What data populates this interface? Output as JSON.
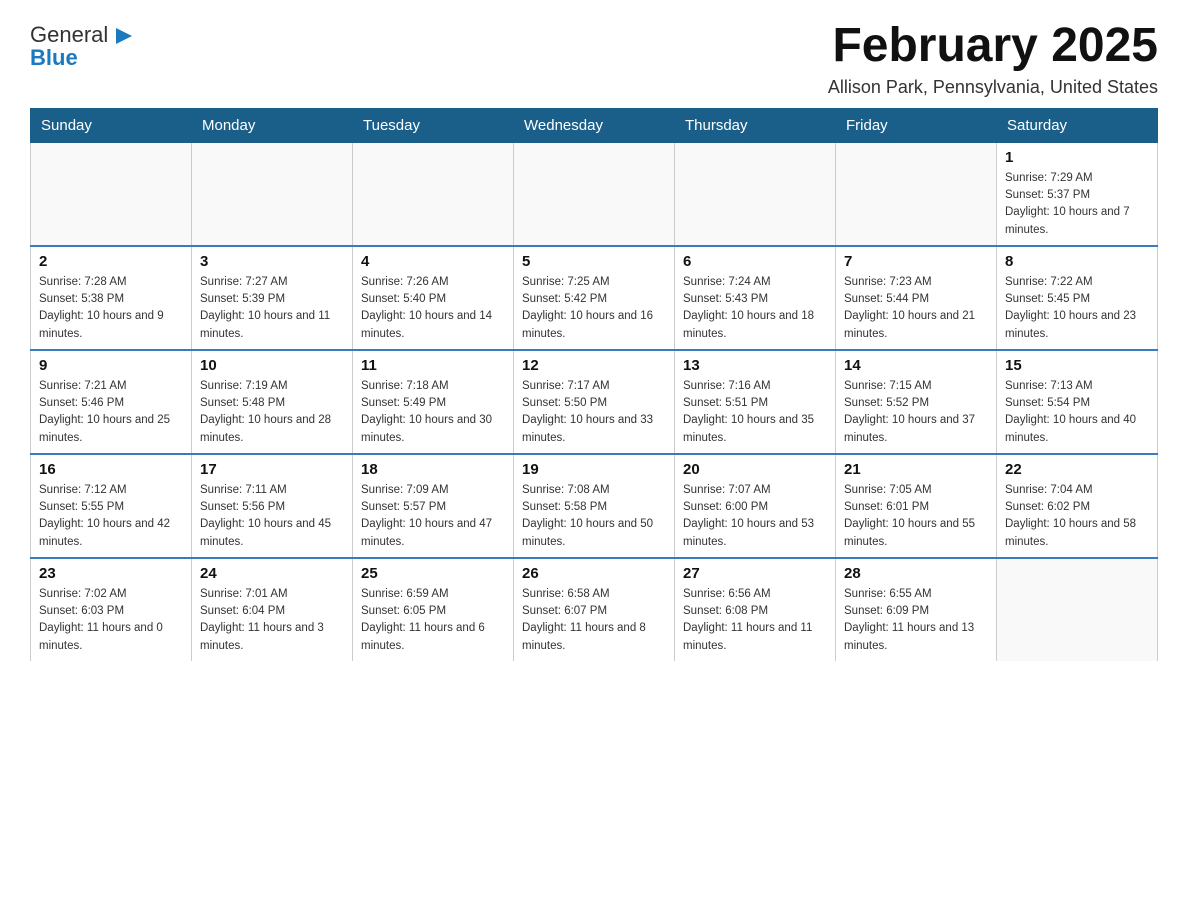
{
  "header": {
    "logo_general": "General",
    "logo_blue": "Blue",
    "month_title": "February 2025",
    "location": "Allison Park, Pennsylvania, United States"
  },
  "days_of_week": [
    "Sunday",
    "Monday",
    "Tuesday",
    "Wednesday",
    "Thursday",
    "Friday",
    "Saturday"
  ],
  "weeks": [
    {
      "days": [
        {
          "number": "",
          "info": ""
        },
        {
          "number": "",
          "info": ""
        },
        {
          "number": "",
          "info": ""
        },
        {
          "number": "",
          "info": ""
        },
        {
          "number": "",
          "info": ""
        },
        {
          "number": "",
          "info": ""
        },
        {
          "number": "1",
          "info": "Sunrise: 7:29 AM\nSunset: 5:37 PM\nDaylight: 10 hours and 7 minutes."
        }
      ]
    },
    {
      "days": [
        {
          "number": "2",
          "info": "Sunrise: 7:28 AM\nSunset: 5:38 PM\nDaylight: 10 hours and 9 minutes."
        },
        {
          "number": "3",
          "info": "Sunrise: 7:27 AM\nSunset: 5:39 PM\nDaylight: 10 hours and 11 minutes."
        },
        {
          "number": "4",
          "info": "Sunrise: 7:26 AM\nSunset: 5:40 PM\nDaylight: 10 hours and 14 minutes."
        },
        {
          "number": "5",
          "info": "Sunrise: 7:25 AM\nSunset: 5:42 PM\nDaylight: 10 hours and 16 minutes."
        },
        {
          "number": "6",
          "info": "Sunrise: 7:24 AM\nSunset: 5:43 PM\nDaylight: 10 hours and 18 minutes."
        },
        {
          "number": "7",
          "info": "Sunrise: 7:23 AM\nSunset: 5:44 PM\nDaylight: 10 hours and 21 minutes."
        },
        {
          "number": "8",
          "info": "Sunrise: 7:22 AM\nSunset: 5:45 PM\nDaylight: 10 hours and 23 minutes."
        }
      ]
    },
    {
      "days": [
        {
          "number": "9",
          "info": "Sunrise: 7:21 AM\nSunset: 5:46 PM\nDaylight: 10 hours and 25 minutes."
        },
        {
          "number": "10",
          "info": "Sunrise: 7:19 AM\nSunset: 5:48 PM\nDaylight: 10 hours and 28 minutes."
        },
        {
          "number": "11",
          "info": "Sunrise: 7:18 AM\nSunset: 5:49 PM\nDaylight: 10 hours and 30 minutes."
        },
        {
          "number": "12",
          "info": "Sunrise: 7:17 AM\nSunset: 5:50 PM\nDaylight: 10 hours and 33 minutes."
        },
        {
          "number": "13",
          "info": "Sunrise: 7:16 AM\nSunset: 5:51 PM\nDaylight: 10 hours and 35 minutes."
        },
        {
          "number": "14",
          "info": "Sunrise: 7:15 AM\nSunset: 5:52 PM\nDaylight: 10 hours and 37 minutes."
        },
        {
          "number": "15",
          "info": "Sunrise: 7:13 AM\nSunset: 5:54 PM\nDaylight: 10 hours and 40 minutes."
        }
      ]
    },
    {
      "days": [
        {
          "number": "16",
          "info": "Sunrise: 7:12 AM\nSunset: 5:55 PM\nDaylight: 10 hours and 42 minutes."
        },
        {
          "number": "17",
          "info": "Sunrise: 7:11 AM\nSunset: 5:56 PM\nDaylight: 10 hours and 45 minutes."
        },
        {
          "number": "18",
          "info": "Sunrise: 7:09 AM\nSunset: 5:57 PM\nDaylight: 10 hours and 47 minutes."
        },
        {
          "number": "19",
          "info": "Sunrise: 7:08 AM\nSunset: 5:58 PM\nDaylight: 10 hours and 50 minutes."
        },
        {
          "number": "20",
          "info": "Sunrise: 7:07 AM\nSunset: 6:00 PM\nDaylight: 10 hours and 53 minutes."
        },
        {
          "number": "21",
          "info": "Sunrise: 7:05 AM\nSunset: 6:01 PM\nDaylight: 10 hours and 55 minutes."
        },
        {
          "number": "22",
          "info": "Sunrise: 7:04 AM\nSunset: 6:02 PM\nDaylight: 10 hours and 58 minutes."
        }
      ]
    },
    {
      "days": [
        {
          "number": "23",
          "info": "Sunrise: 7:02 AM\nSunset: 6:03 PM\nDaylight: 11 hours and 0 minutes."
        },
        {
          "number": "24",
          "info": "Sunrise: 7:01 AM\nSunset: 6:04 PM\nDaylight: 11 hours and 3 minutes."
        },
        {
          "number": "25",
          "info": "Sunrise: 6:59 AM\nSunset: 6:05 PM\nDaylight: 11 hours and 6 minutes."
        },
        {
          "number": "26",
          "info": "Sunrise: 6:58 AM\nSunset: 6:07 PM\nDaylight: 11 hours and 8 minutes."
        },
        {
          "number": "27",
          "info": "Sunrise: 6:56 AM\nSunset: 6:08 PM\nDaylight: 11 hours and 11 minutes."
        },
        {
          "number": "28",
          "info": "Sunrise: 6:55 AM\nSunset: 6:09 PM\nDaylight: 11 hours and 13 minutes."
        },
        {
          "number": "",
          "info": ""
        }
      ]
    }
  ]
}
